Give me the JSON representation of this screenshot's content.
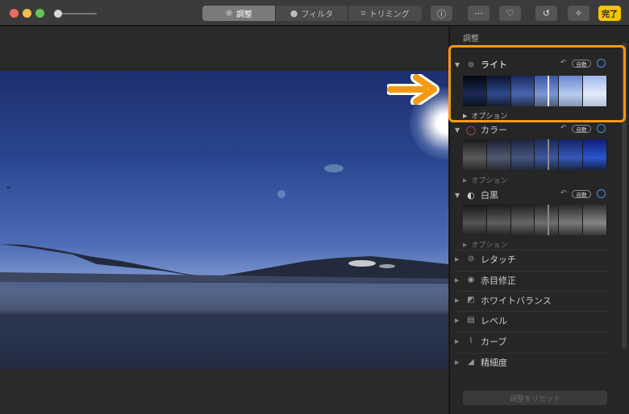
{
  "toolbar": {
    "segments": [
      {
        "label": "調整",
        "icon": "sun-icon"
      },
      {
        "label": "フィルタ",
        "icon": "filter-circles-icon"
      },
      {
        "label": "トリミング",
        "icon": "crop-icon"
      }
    ],
    "done_label": "完了",
    "icons": [
      "info-icon",
      "more-icon",
      "heart-icon",
      "rotate-icon",
      "magic-wand-icon"
    ]
  },
  "panel": {
    "title": "調整",
    "sections": [
      {
        "label": "ライト",
        "auto": "自動",
        "option": "オプション"
      },
      {
        "label": "カラー",
        "auto": "自動",
        "option": "オプション"
      },
      {
        "label": "白黒",
        "auto": "自動",
        "option": "オプション"
      }
    ],
    "items": [
      {
        "label": "レタッチ",
        "icon": "bandage-icon"
      },
      {
        "label": "赤目修正",
        "icon": "eye-icon"
      },
      {
        "label": "ホワイトバランス",
        "icon": "white-balance-icon"
      },
      {
        "label": "レベル",
        "icon": "levels-icon"
      },
      {
        "label": "カーブ",
        "icon": "curves-icon"
      },
      {
        "label": "精細度",
        "icon": "definition-icon"
      }
    ],
    "reset_label": "調整をリセット"
  },
  "colors": {
    "accent": "#f5c400",
    "highlight": "#f39a12",
    "blue": "#4a8ff0"
  }
}
